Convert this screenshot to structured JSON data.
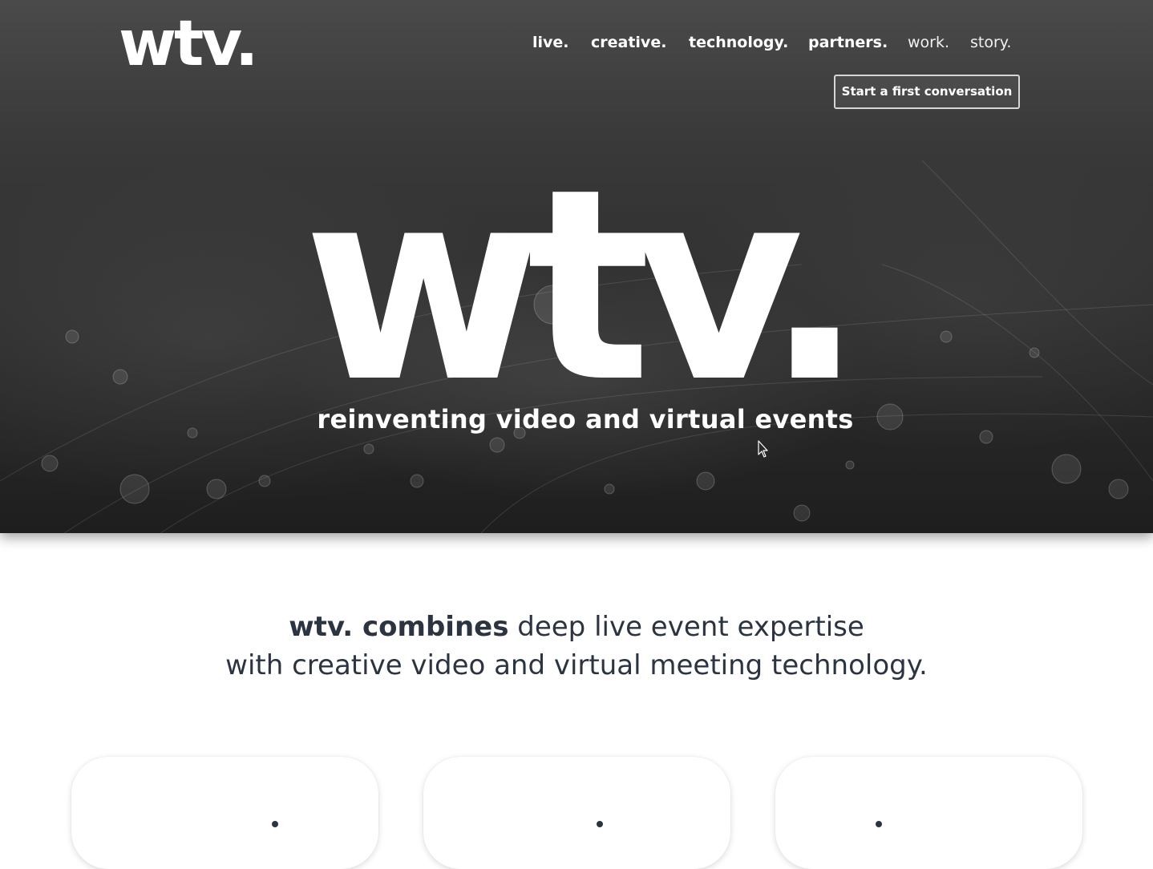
{
  "header": {
    "logo_text": "wtv.",
    "nav": [
      {
        "label": "live.",
        "style": "bold"
      },
      {
        "label": "creative.",
        "style": "bold"
      },
      {
        "label": "technology.",
        "style": "bold"
      },
      {
        "label": "partners.",
        "style": "bold"
      },
      {
        "label": "work.",
        "style": "light"
      },
      {
        "label": "story.",
        "style": "light"
      }
    ],
    "cta_label": "Start a first conversation"
  },
  "hero": {
    "wordmark": "wtv.",
    "tagline": "reinventing video and virtual events",
    "icons": [
      "cursor-icon"
    ]
  },
  "intro": {
    "bold_part": "wtv. combines",
    "line1_rest": " deep live event expertise",
    "line2": "with creative video and virtual meeting technology."
  },
  "cards": [
    {
      "name": "card-1"
    },
    {
      "name": "card-2"
    },
    {
      "name": "card-3"
    }
  ],
  "colors": {
    "hero_dark": "#2f2f2f",
    "text_dark": "#2b3440",
    "white": "#ffffff"
  }
}
